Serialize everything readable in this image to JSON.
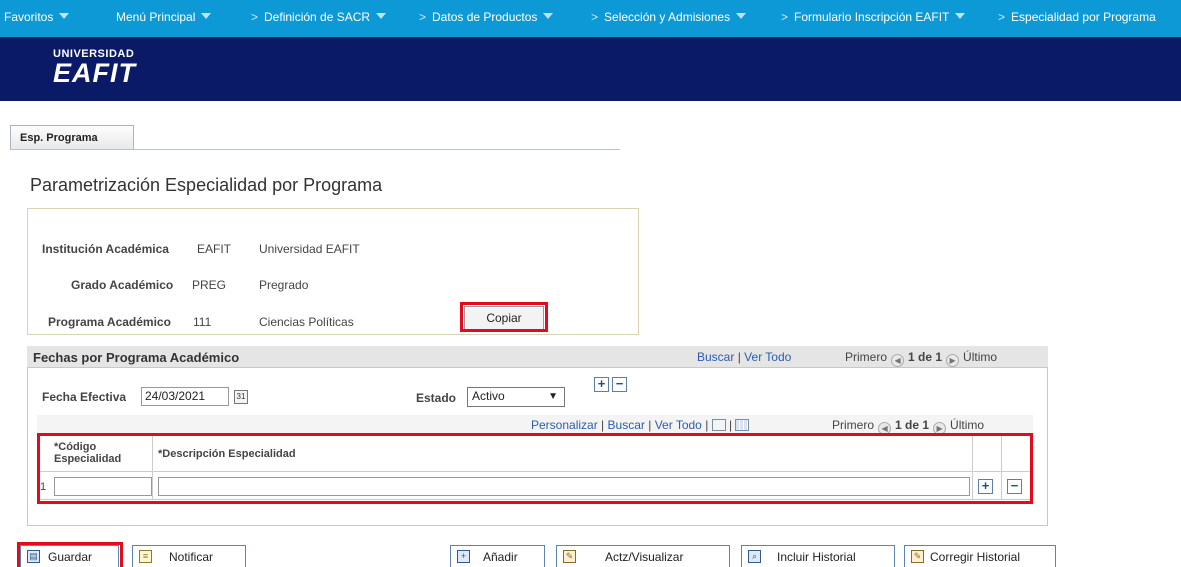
{
  "topnav": {
    "items": [
      "Favoritos",
      "Menú Principal",
      "Definición de SACR",
      "Datos de Productos",
      "Selección y Admisiones",
      "Formulario Inscripción EAFIT",
      "Especialidad por Programa"
    ],
    "separator": ">"
  },
  "logo": {
    "line1": "UNIVERSIDAD",
    "line2": "EAFIT"
  },
  "tab": {
    "label": "Esp. Programa"
  },
  "page": {
    "title": "Parametrización Especialidad por Programa"
  },
  "keys": {
    "institucion": {
      "label": "Institución Académica",
      "code": "EAFIT",
      "desc": "Universidad EAFIT"
    },
    "grado": {
      "label": "Grado Académico",
      "code": "PREG",
      "desc": "Pregrado"
    },
    "programa": {
      "label": "Programa Académico",
      "code": "111",
      "desc": "Ciencias Políticas"
    },
    "copy_button": "Copiar"
  },
  "fechas": {
    "title": "Fechas por Programa Académico",
    "buscar": "Buscar",
    "ver_todo": "Ver Todo",
    "primero": "Primero",
    "count": "1 de 1",
    "ultimo": "Último",
    "fecha_label": "Fecha Efectiva",
    "fecha_value": "24/03/2021",
    "estado_label": "Estado",
    "estado_value": "Activo"
  },
  "grid": {
    "personalizar": "Personalizar",
    "buscar": "Buscar",
    "ver_todo": "Ver Todo",
    "primero": "Primero",
    "count": "1 de 1",
    "ultimo": "Último",
    "col1_line1": "*Código",
    "col1_line2": "Especialidad",
    "col2": "*Descripción Especialidad",
    "row_number": "1"
  },
  "toolbar": {
    "guardar": "Guardar",
    "notificar": "Notificar",
    "anadir": "Añadir",
    "actualizar": "Actz/Visualizar",
    "incluir": "Incluir Historial",
    "corregir": "Corregir Historial"
  },
  "colors": {
    "nav": "#0d99d5",
    "header": "#0b1a66",
    "highlight": "#e10b1b"
  }
}
